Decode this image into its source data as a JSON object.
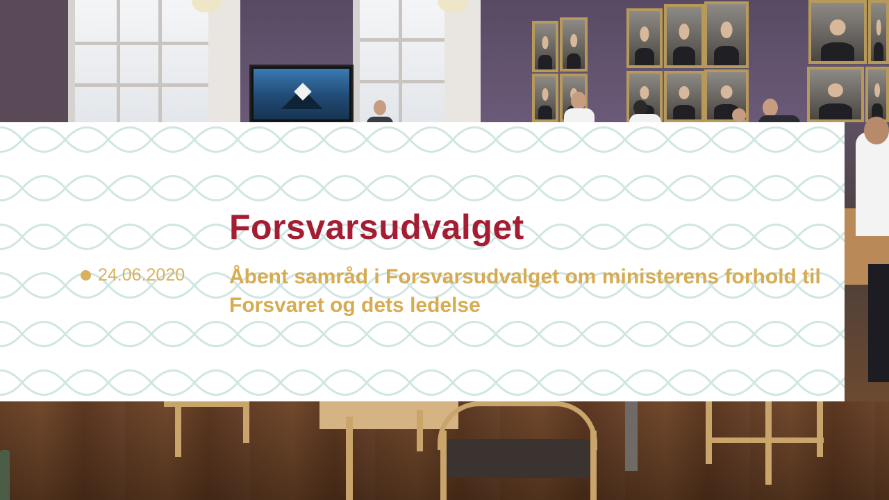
{
  "banner": {
    "committee": "Forsvarsudvalget",
    "date": "24.06.2020",
    "subject": "Åbent samråd i Forsvarsudvalget om ministerens forhold til Forsvaret og dets ledelse"
  },
  "colors": {
    "committee_text": "#a41d32",
    "subject_text": "#d6ab52",
    "date_text": "#d8b15a",
    "card_background": "#ffffff",
    "pattern_stroke": "#cfe6e2"
  },
  "background_scene": "meeting-room-photo"
}
